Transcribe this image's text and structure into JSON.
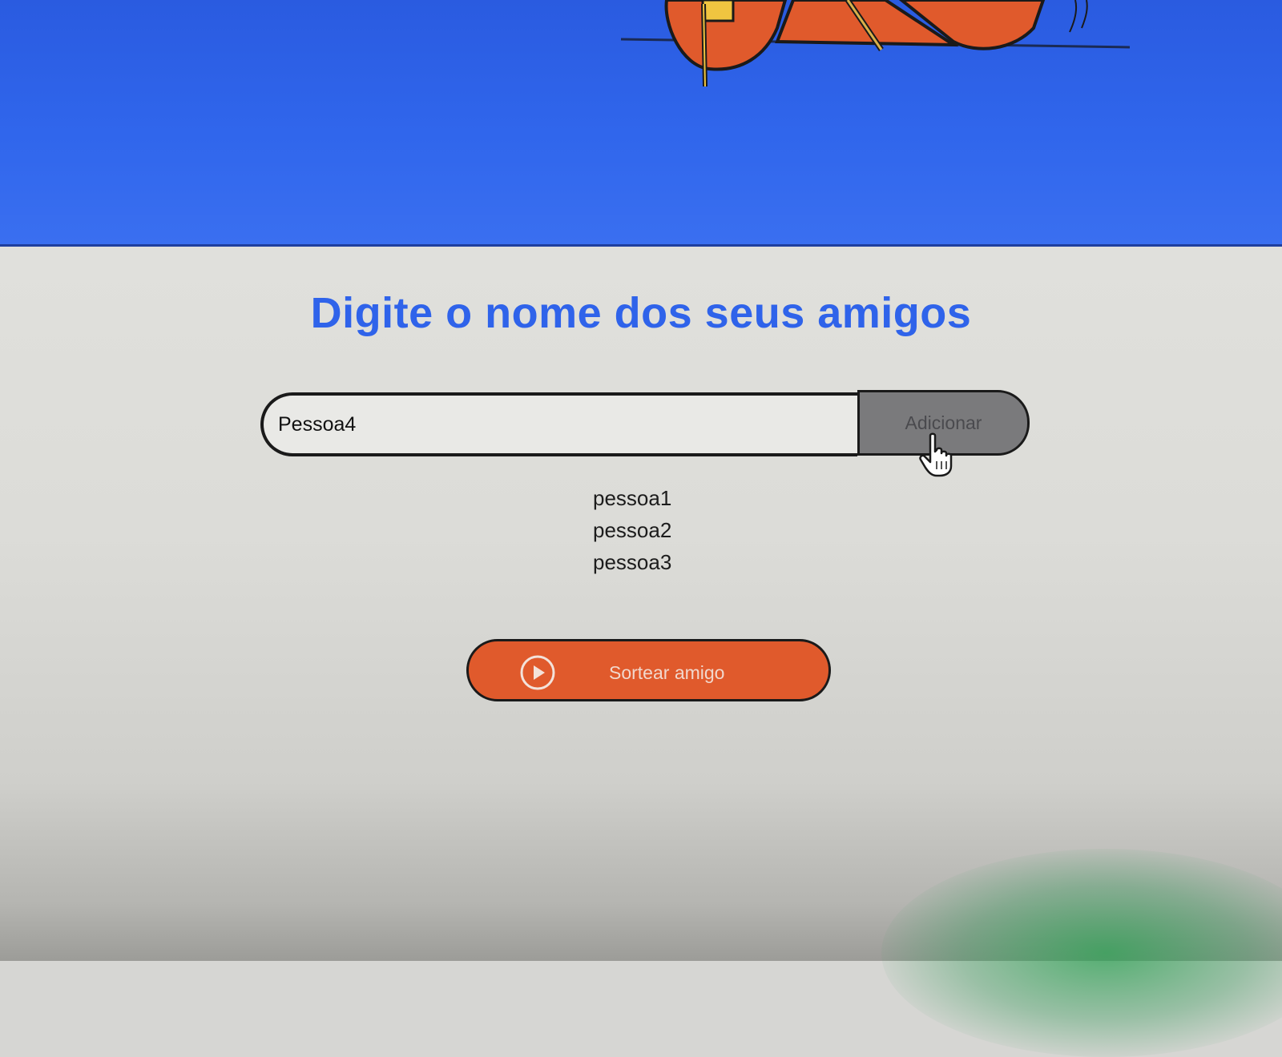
{
  "heading": {
    "title": "Digite o nome dos seus amigos"
  },
  "input": {
    "value": "Pessoa4"
  },
  "buttons": {
    "add_label": "Adicionar",
    "draw_label": "Sortear amigo",
    "draw_icon": "play-icon"
  },
  "friends": [
    "pessoa1",
    "pessoa2",
    "pessoa3"
  ],
  "colors": {
    "header_blue": "#3066ec",
    "title_blue": "#2f63ea",
    "accent_orange": "#e05a2c",
    "add_button_gray": "#7a7a7c"
  }
}
